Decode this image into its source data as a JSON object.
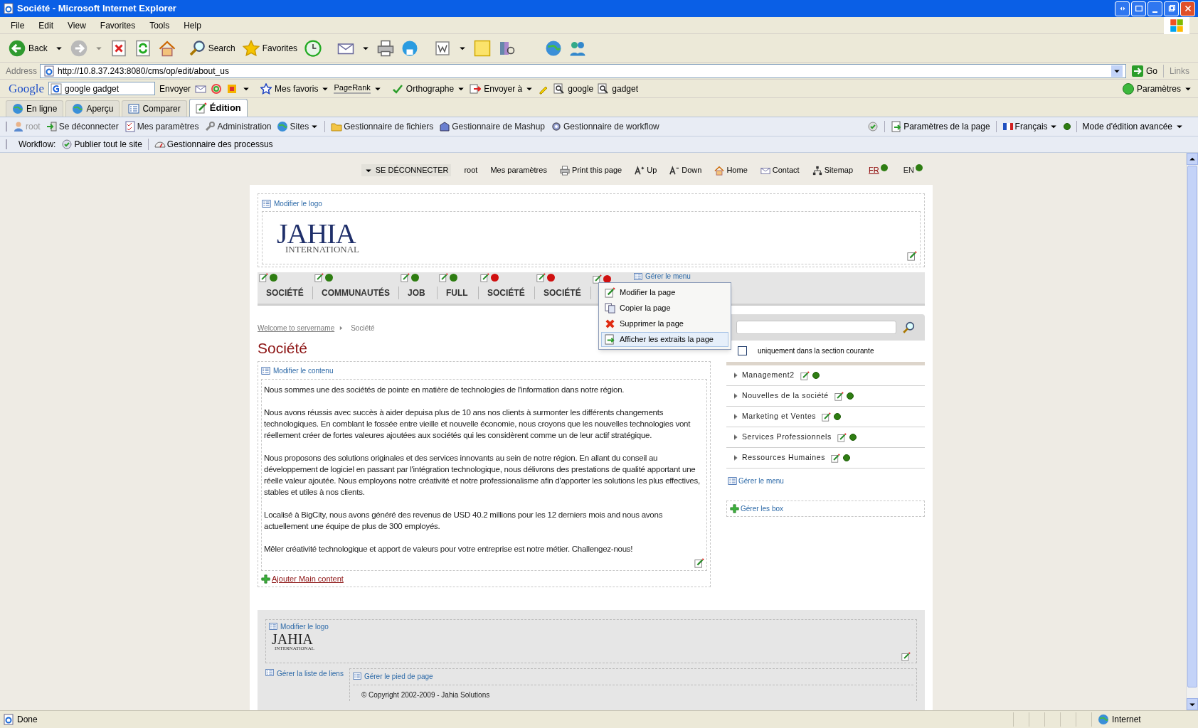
{
  "window": {
    "title": "Société - Microsoft Internet Explorer"
  },
  "menu_bar": [
    "File",
    "Edit",
    "View",
    "Favorites",
    "Tools",
    "Help"
  ],
  "toolbar": {
    "back": "Back",
    "search": "Search",
    "favorites": "Favorites"
  },
  "address_bar": {
    "label": "Address",
    "value": "http://10.8.37.243:8080/cms/op/edit/about_us",
    "go": "Go",
    "links": "Links"
  },
  "google_toolbar": {
    "logo": "Google",
    "search_value": "google gadget",
    "send": "Envoyer",
    "favorites": "Mes favoris",
    "pagerank": "PageRank",
    "spelling": "Orthographe",
    "send_to": "Envoyer à",
    "highlight_1": "google",
    "highlight_2": "gadget",
    "settings": "Paramètres"
  },
  "jahia_tabs": [
    {
      "label": "En ligne",
      "selected": false
    },
    {
      "label": "Aperçu",
      "selected": false
    },
    {
      "label": "Comparer",
      "selected": false
    },
    {
      "label": "Édition",
      "selected": true
    }
  ],
  "jahia_toolbar": {
    "items": [
      {
        "label": "root",
        "disabled": true
      },
      {
        "label": "Se déconnecter",
        "disabled": false
      },
      {
        "label": "Mes paramètres",
        "disabled": false
      },
      {
        "label": "Administration",
        "disabled": false
      },
      {
        "label": "Sites",
        "disabled": false
      },
      {
        "label": "Gestionnaire de fichiers",
        "disabled": false
      },
      {
        "label": "Gestionnaire de Mashup",
        "disabled": false
      },
      {
        "label": "Gestionnaire de workflow",
        "disabled": false
      }
    ],
    "right_items": [
      "Paramètres de la page",
      "Français",
      "Mode d'édition avancée"
    ]
  },
  "workflow_bar": {
    "label": "Workflow:",
    "items": [
      "Publier tout le site",
      "Gestionnaire des processus"
    ]
  },
  "top_links": {
    "logout": "SE DÉCONNECTER",
    "user": "root",
    "items": [
      "Mes paramètres",
      "Print this page",
      "Up",
      "Down",
      "Home",
      "Contact",
      "Sitemap"
    ],
    "languages": [
      {
        "label": "FR",
        "selected": true
      },
      {
        "label": "EN",
        "selected": false
      }
    ]
  },
  "header": {
    "edit_logo": "Modifier le logo",
    "logo": "JAHIA",
    "logo_subtitle": "INTERNATIONAL"
  },
  "nav": {
    "items": [
      {
        "label": "SOCIÉTÉ",
        "color": "#2e7d12"
      },
      {
        "label": "COMMUNAUTÉS",
        "color": "#2e7d12"
      },
      {
        "label": "JOB",
        "color": "#2e7d12"
      },
      {
        "label": "FULL",
        "color": "#2e7d12"
      },
      {
        "label": "SOCIÉTÉ",
        "color": "#d01010"
      },
      {
        "label": "SOCIÉTÉ",
        "color": "#d01010"
      },
      {
        "color": "#d01010"
      }
    ],
    "manage_menu": "Gérer le menu"
  },
  "context_menu": [
    {
      "label": "Modifier la page",
      "kind": "edit",
      "selected": false
    },
    {
      "label": "Copier la page",
      "kind": "copy",
      "selected": false
    },
    {
      "label": "Supprimer la page",
      "kind": "delete",
      "selected": false
    },
    {
      "label": "Afficher les extraits la page",
      "kind": "extract",
      "selected": true
    }
  ],
  "breadcrumb": [
    "Welcome to servername",
    "Société"
  ],
  "page_title": "Société",
  "content": {
    "edit_link": "Modifier le contenu",
    "paragraphs": [
      "Nous sommes une des sociétés de pointe en matière de technologies de l'information dans notre région.",
      "Nous avons réussis avec succès à aider depuisa plus de 10 ans nos clients à surmonter les différents changements technologiques. En comblant le fossée entre vieille et nouvelle économie, nous croyons que les nouvelles technologies vont réellement créer de fortes valeures ajoutées aux sociétés qui les considèrent comme un de leur actif stratégique.",
      "Nous proposons des solutions originales et des services innovants au sein de notre région. En allant du conseil au développement de logiciel en passant par l'intégration technologique, nous délivrons des prestations de qualité apportant une réelle valeur ajoutée. Nous employons notre créativité et notre professionalisme afin d'apporter les solutions les plus effectives, stables et utiles à nos clients.",
      "Localisé à BigCity, nous avons généré des revenus de USD 40.2 millions pour les 12 derniers mois and nous avons actuellement une équipe de plus de 300 employés.",
      "Mêler créativité technologique et apport de valeurs pour votre entreprise est notre métier. Challengez-nous!"
    ],
    "add_link": "Ajouter Main content"
  },
  "search": {
    "scope_checkbox": {
      "label": "uniquement dans la section courante",
      "checked": false
    }
  },
  "sidebar": {
    "items": [
      "Management2",
      "Nouvelles de la société",
      "Marketing et Ventes",
      "Services Professionnels",
      "Ressources Humaines"
    ],
    "manage_menu": "Gérer le menu",
    "manage_boxes": "Gérer les box"
  },
  "footer": {
    "edit_logo": "Modifier le logo",
    "logo": "JAHIA",
    "logo_subtitle": "INTERNATIONAL",
    "manage_links": "Gérer la liste de liens",
    "manage_footer": "Gérer le pied de page",
    "copyright": "© Copyright 2002-2009 - Jahia Solutions"
  },
  "status_bar": {
    "text": "Done",
    "zone": "Internet"
  }
}
